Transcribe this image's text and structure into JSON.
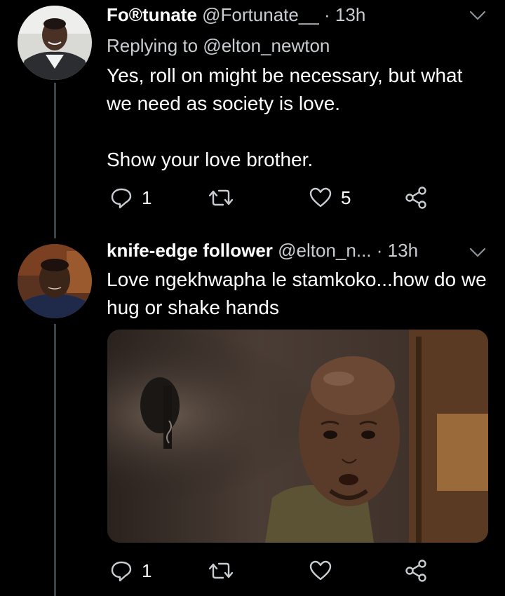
{
  "tweets": [
    {
      "display_name": "Fo®tunate",
      "handle": "@Fortunate__",
      "time": "13h",
      "replying_to": "Replying to @elton_newton",
      "text": "Yes, roll on might be necessary, but what we need as society is love.\n\nShow your love brother.",
      "reply_count": "1",
      "retweet_count": "",
      "like_count": "5"
    },
    {
      "display_name": "knife-edge follower",
      "handle": "@elton_n...",
      "time": "13h",
      "text": "Love ngekhwapha le stamkoko...how do we hug or shake hands",
      "reply_count": "1",
      "retweet_count": "",
      "like_count": ""
    }
  ],
  "separator": "·",
  "colors": {
    "background": "#000000",
    "text": "#ffffff",
    "secondary_text": "#c9cdd1",
    "thread_line": "#3d4247",
    "icon": "#c9cdd1"
  },
  "icons": [
    "chevron-down-icon",
    "reply-icon",
    "retweet-icon",
    "like-icon",
    "share-icon"
  ]
}
